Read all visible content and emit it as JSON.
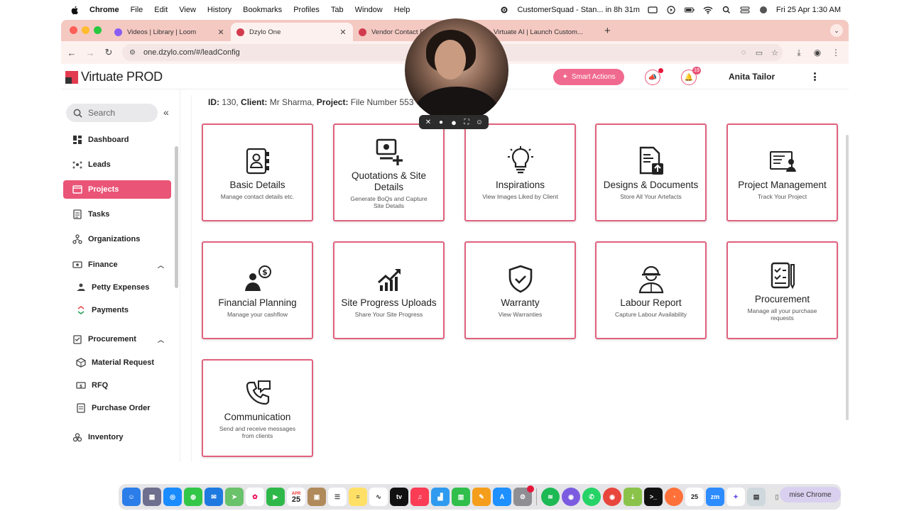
{
  "menubar": {
    "app": "Chrome",
    "items": [
      "File",
      "Edit",
      "View",
      "History",
      "Bookmarks",
      "Profiles",
      "Tab",
      "Window",
      "Help"
    ],
    "status_app": "CustomerSquad - Stan... in 8h 31m",
    "datetime": "Fri 25 Apr  1:30 AM"
  },
  "browser": {
    "tabs": [
      {
        "label": "Videos | Library | Loom",
        "color": "#8a5cf6"
      },
      {
        "label": "Dzylo One",
        "color": "#d23b4e"
      },
      {
        "label": "Vendor Contact F...",
        "color": "#d23b4e"
      },
      {
        "label": "Virtuate AI | Launch Custom...",
        "color": "#4a90d9"
      }
    ],
    "url": "one.dzylo.com/#/leadConfig"
  },
  "header": {
    "brand": "Virtuate PROD",
    "smart_actions": "Smart Actions",
    "notif_count": "19",
    "user_name": "Anita Tailor"
  },
  "sidebar": {
    "search_placeholder": "Search",
    "items": [
      {
        "label": "Dashboard",
        "icon": "dashboard-icon"
      },
      {
        "label": "Leads",
        "icon": "leads-icon"
      },
      {
        "label": "Projects",
        "icon": "projects-icon",
        "active": true
      },
      {
        "label": "Tasks",
        "icon": "tasks-icon"
      },
      {
        "label": "Organizations",
        "icon": "organizations-icon"
      },
      {
        "label": "Finance",
        "icon": "finance-icon",
        "expanded": true
      },
      {
        "label": "Petty Expenses",
        "icon": "petty-expenses-icon",
        "sub": true
      },
      {
        "label": "Payments",
        "icon": "payments-icon",
        "sub": true
      },
      {
        "label": "Procurement",
        "icon": "procurement-icon",
        "expanded": true
      },
      {
        "label": "Material Request",
        "icon": "material-request-icon",
        "sub": true
      },
      {
        "label": "RFQ",
        "icon": "rfq-icon",
        "sub": true
      },
      {
        "label": "Purchase Order",
        "icon": "purchase-order-icon",
        "sub": true
      },
      {
        "label": "Inventory",
        "icon": "inventory-icon"
      }
    ]
  },
  "project": {
    "id_label": "ID:",
    "id": "130,",
    "client_label": "Client:",
    "client": "Mr Sharma,",
    "project_label": "Project:",
    "project": "File Number 553"
  },
  "cards": [
    {
      "title": "Basic Details",
      "sub": "Manage contact details etc.",
      "icon": "contact-book-icon"
    },
    {
      "title": "Quotations & Site Details",
      "sub": "Generate BoQs and Capture Site Details",
      "icon": "quotation-icon"
    },
    {
      "title": "Inspirations",
      "sub": "View Images Liked by Client",
      "icon": "lightbulb-icon"
    },
    {
      "title": "Designs & Documents",
      "sub": "Store All Your Artefacts",
      "icon": "document-upload-icon"
    },
    {
      "title": "Project Management",
      "sub": "Track Your Project",
      "icon": "project-board-icon"
    },
    {
      "title": "Financial Planning",
      "sub": "Manage your cashflow",
      "icon": "finance-people-icon"
    },
    {
      "title": "Site Progress Uploads",
      "sub": "Share Your Site Progress",
      "icon": "progress-chart-icon"
    },
    {
      "title": "Warranty",
      "sub": "View Warranties",
      "icon": "shield-check-icon"
    },
    {
      "title": "Labour Report",
      "sub": "Capture Labour Availability",
      "icon": "worker-icon"
    },
    {
      "title": "Procurement",
      "sub": "Manage all your purchase requests",
      "icon": "clipboard-check-icon"
    },
    {
      "title": "Communication",
      "sub": "Send and receive messages from clients",
      "icon": "phone-message-icon"
    }
  ],
  "dock": {
    "calendar_month": "APR",
    "calendar_day": "25",
    "minimise_label": "mise Chrome"
  }
}
